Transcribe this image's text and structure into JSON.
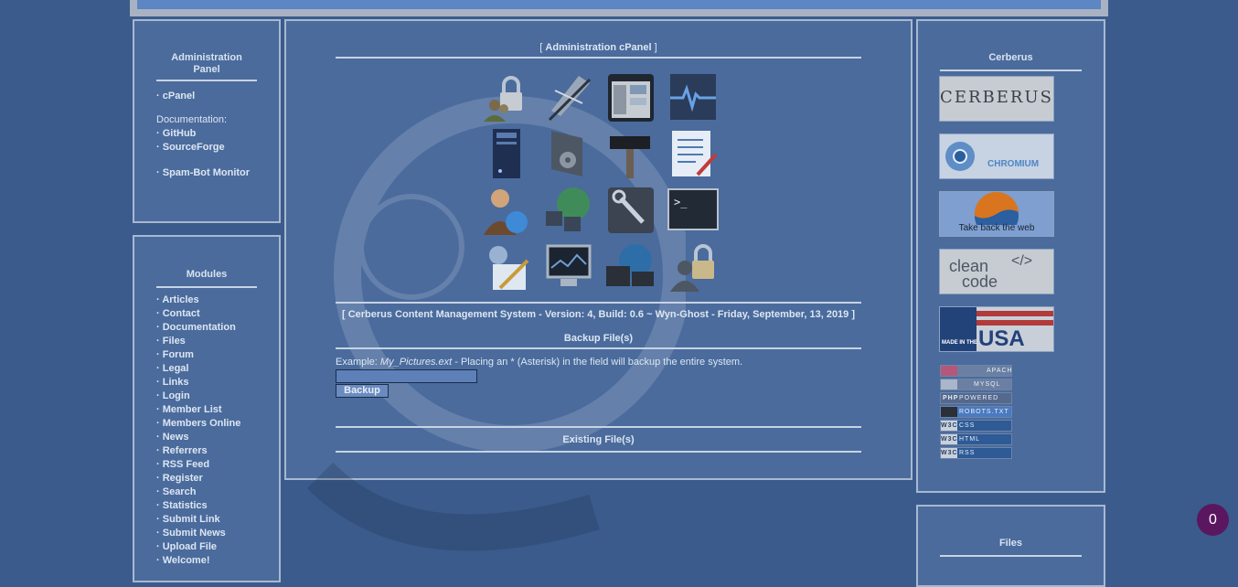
{
  "admin_panel": {
    "title_line1": "Administration",
    "title_line2": "Panel",
    "links": [
      "cPanel"
    ],
    "doc_label": "Documentation:",
    "doc_links": [
      "GitHub",
      "SourceForge"
    ],
    "extra_links": [
      "Spam-Bot Monitor"
    ]
  },
  "modules": {
    "title": "Modules",
    "items": [
      "Articles",
      "Contact",
      "Documentation",
      "Files",
      "Forum",
      "Legal",
      "Links",
      "Login",
      "Member List",
      "Members Online",
      "News",
      "Referrers",
      "RSS Feed",
      "Register",
      "Search",
      "Statistics",
      "Submit Link",
      "Submit News",
      "Upload File",
      "Welcome!"
    ]
  },
  "center": {
    "header_open": "[ ",
    "header": "Administration cPanel",
    "header_close": " ]",
    "version_line": "[ Cerberus Content Management System - Version: 4, Build: 0.6 ~ Wyn-Ghost - Friday, September, 13, 2019 ]",
    "backup_title": "Backup File(s)",
    "example_prefix": "Example: ",
    "example_file": "My_Pictures.ext",
    "example_suffix": " - Placing an * (Asterisk) in the field will backup the entire system.",
    "backup_input_value": "",
    "backup_button": "Backup",
    "existing_title": "Existing File(s)",
    "icons": [
      "users-lock-icon",
      "quill-pen-icon",
      "app-window-icon",
      "activity-monitor-icon",
      "server-tower-icon",
      "settings-folder-icon",
      "hammer-icon",
      "text-document-icon",
      "admin-person-icon",
      "network-globe-icon",
      "wrench-icon",
      "terminal-icon",
      "user-edit-icon",
      "monitor-screen-icon",
      "devices-globe-icon",
      "user-lock-icon"
    ]
  },
  "cerberus_panel": {
    "title": "Cerberus",
    "banners": {
      "cerberus": "CERBERUS",
      "chromium": "CHROMIUM",
      "firefox": "Take back the web",
      "clean_code_1": "clean",
      "clean_code_2": "code",
      "clean_code_tag": "</>",
      "usa_small": "MADE IN THE",
      "usa": "USA"
    },
    "badges": [
      {
        "tag": "",
        "label": "APACHE"
      },
      {
        "tag": "",
        "label": "MYSQL"
      },
      {
        "tag": "PHP",
        "label": "POWERED"
      },
      {
        "tag": "",
        "label": "ROBOTS.TXT"
      },
      {
        "tag": "W3C",
        "label": "CSS"
      },
      {
        "tag": "W3C",
        "label": "HTML"
      },
      {
        "tag": "W3C",
        "label": "RSS"
      }
    ]
  },
  "files_panel": {
    "title": "Files"
  },
  "notification_count": "0"
}
